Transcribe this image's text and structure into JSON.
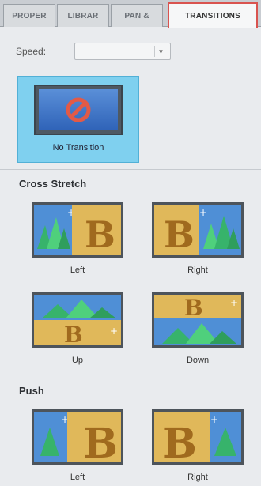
{
  "tabs": [
    {
      "label": "PROPER"
    },
    {
      "label": "LIBRAR"
    },
    {
      "label": "PAN &"
    },
    {
      "label": "TRANSITIONS"
    }
  ],
  "speed": {
    "label": "Speed:",
    "value": ""
  },
  "no_transition": {
    "label": "No Transition"
  },
  "sections": [
    {
      "title": "Cross Stretch",
      "items": [
        {
          "label": "Left"
        },
        {
          "label": "Right"
        },
        {
          "label": "Up"
        },
        {
          "label": "Down"
        }
      ]
    },
    {
      "title": "Push",
      "items": [
        {
          "label": "Left"
        },
        {
          "label": "Right"
        }
      ]
    }
  ],
  "colors": {
    "active_tab_border": "#d9534f",
    "selected_card": "#7fd0ef",
    "scene_blue": "#4f8fd6",
    "scene_gold": "#e0b85a",
    "letter": "#a06a1e"
  },
  "icons": {
    "no_transition": "prohibited-icon"
  }
}
